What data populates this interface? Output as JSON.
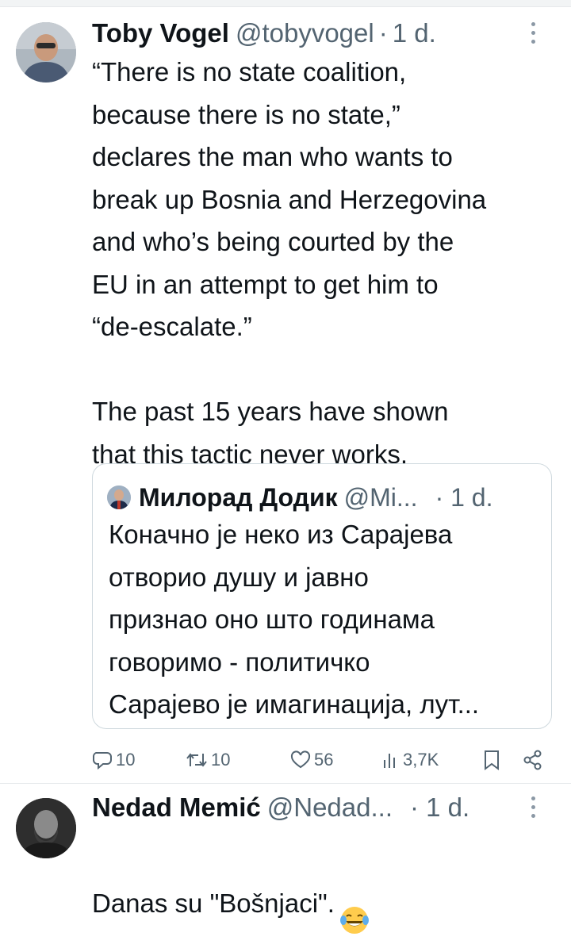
{
  "tweet1": {
    "name": "Toby Vogel",
    "handle": "@tobyvogel",
    "dot": "·",
    "time": "1 d.",
    "text": "“There is no state coalition,\nbecause there is no state,”\ndeclares the man who wants to\nbreak up Bosnia and Herzegovina\nand who’s being courted by the\nEU in an attempt to get him to\n“de-escalate.”\n\nThe past 15 years have shown\nthat this tactic never works.",
    "quote": {
      "name": "Милорад Додик",
      "handle": "@Mi...",
      "time": "· 1 d.",
      "text": "Коначно је неко из Сарајева\nотворио душу и јавно\nпризнао оно што годинама\nговоримо - политичко\nСарајево је имагинација, лут..."
    },
    "actions": {
      "replies": "10",
      "retweets": "10",
      "likes": "56",
      "views": "3,7K"
    }
  },
  "tweet2": {
    "name": "Nedad Memić",
    "handle": "@Nedad...",
    "time": "· 1 d.",
    "text": "Danas su \"Bošnjaci\"."
  },
  "icons": {
    "reply": "reply-icon",
    "retweet": "retweet-icon",
    "like": "heart-icon",
    "views": "views-icon",
    "bookmark": "bookmark-icon",
    "share": "share-icon",
    "more": "more-icon",
    "emoji": "face-with-tears-of-joy-emoji"
  }
}
